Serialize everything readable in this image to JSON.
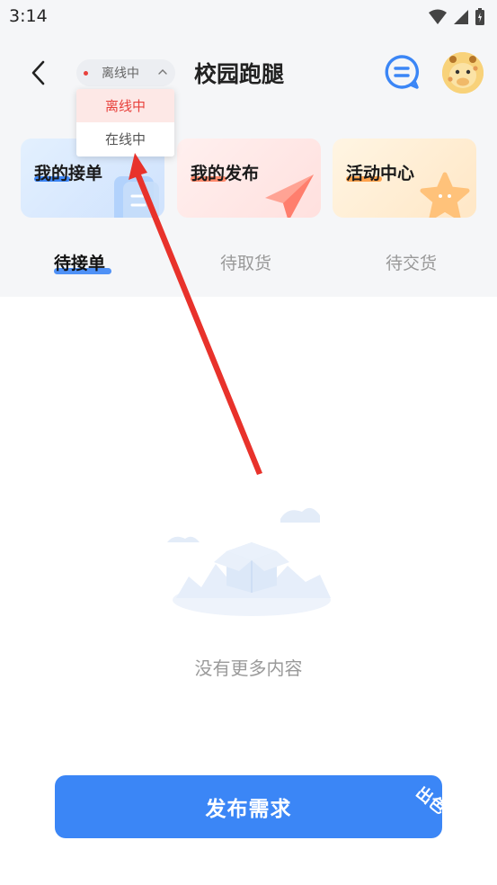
{
  "status_bar": {
    "time": "3:14"
  },
  "header": {
    "title": "校园跑腿",
    "status_selector": {
      "current": "离线中"
    }
  },
  "dropdown": {
    "options": [
      {
        "label": "离线中",
        "selected": true
      },
      {
        "label": "在线中",
        "selected": false
      }
    ]
  },
  "cards": [
    {
      "label": "我的接单",
      "accent": "#3d86f5"
    },
    {
      "label": "我的发布",
      "accent": "#ff8a6c"
    },
    {
      "label": "活动中心",
      "accent": "#ffa34d"
    }
  ],
  "tabs": [
    {
      "label": "待接单",
      "active": true
    },
    {
      "label": "待取货",
      "active": false
    },
    {
      "label": "待交货",
      "active": false
    }
  ],
  "empty_state": {
    "text": "没有更多内容"
  },
  "publish_button": {
    "label": "发布需求",
    "stamp": "出色"
  },
  "colors": {
    "primary": "#3b86f6",
    "offline_red": "#e8413c",
    "annotation_arrow": "#e8322b"
  }
}
